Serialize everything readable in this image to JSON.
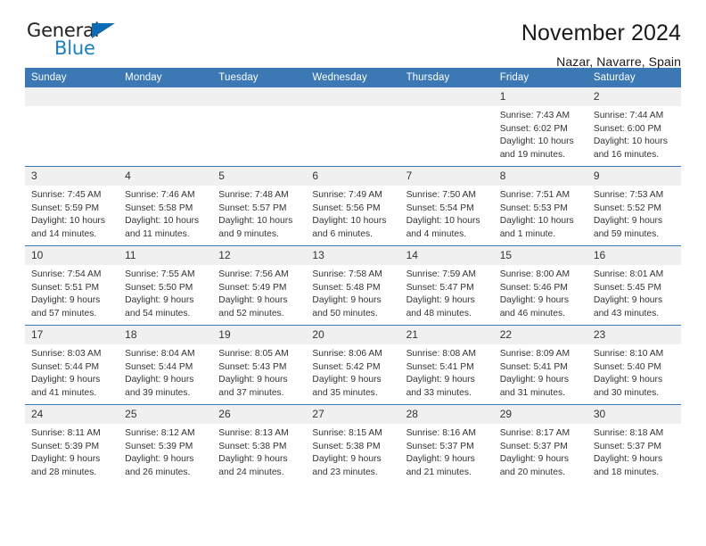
{
  "logo": {
    "word_one": "General",
    "word_two": "Blue",
    "triangle": "blue-triangle-icon",
    "brand_dark": "#231f20",
    "brand_blue": "#1a7fc1"
  },
  "header": {
    "title": "November 2024",
    "subtitle": "Nazar, Navarre, Spain"
  },
  "theme": {
    "header_blue": "#3b78b4",
    "daynum_band": "#f0f0f0",
    "text": "#333333"
  },
  "calendar": {
    "weekday_headers": [
      "Sunday",
      "Monday",
      "Tuesday",
      "Wednesday",
      "Thursday",
      "Friday",
      "Saturday"
    ],
    "weeks": [
      [
        {
          "day": "",
          "sunrise": "",
          "sunset": "",
          "daylight_line1": "",
          "daylight_line2": ""
        },
        {
          "day": "",
          "sunrise": "",
          "sunset": "",
          "daylight_line1": "",
          "daylight_line2": ""
        },
        {
          "day": "",
          "sunrise": "",
          "sunset": "",
          "daylight_line1": "",
          "daylight_line2": ""
        },
        {
          "day": "",
          "sunrise": "",
          "sunset": "",
          "daylight_line1": "",
          "daylight_line2": ""
        },
        {
          "day": "",
          "sunrise": "",
          "sunset": "",
          "daylight_line1": "",
          "daylight_line2": ""
        },
        {
          "day": "1",
          "sunrise": "Sunrise: 7:43 AM",
          "sunset": "Sunset: 6:02 PM",
          "daylight_line1": "Daylight: 10 hours",
          "daylight_line2": "and 19 minutes."
        },
        {
          "day": "2",
          "sunrise": "Sunrise: 7:44 AM",
          "sunset": "Sunset: 6:00 PM",
          "daylight_line1": "Daylight: 10 hours",
          "daylight_line2": "and 16 minutes."
        }
      ],
      [
        {
          "day": "3",
          "sunrise": "Sunrise: 7:45 AM",
          "sunset": "Sunset: 5:59 PM",
          "daylight_line1": "Daylight: 10 hours",
          "daylight_line2": "and 14 minutes."
        },
        {
          "day": "4",
          "sunrise": "Sunrise: 7:46 AM",
          "sunset": "Sunset: 5:58 PM",
          "daylight_line1": "Daylight: 10 hours",
          "daylight_line2": "and 11 minutes."
        },
        {
          "day": "5",
          "sunrise": "Sunrise: 7:48 AM",
          "sunset": "Sunset: 5:57 PM",
          "daylight_line1": "Daylight: 10 hours",
          "daylight_line2": "and 9 minutes."
        },
        {
          "day": "6",
          "sunrise": "Sunrise: 7:49 AM",
          "sunset": "Sunset: 5:56 PM",
          "daylight_line1": "Daylight: 10 hours",
          "daylight_line2": "and 6 minutes."
        },
        {
          "day": "7",
          "sunrise": "Sunrise: 7:50 AM",
          "sunset": "Sunset: 5:54 PM",
          "daylight_line1": "Daylight: 10 hours",
          "daylight_line2": "and 4 minutes."
        },
        {
          "day": "8",
          "sunrise": "Sunrise: 7:51 AM",
          "sunset": "Sunset: 5:53 PM",
          "daylight_line1": "Daylight: 10 hours",
          "daylight_line2": "and 1 minute."
        },
        {
          "day": "9",
          "sunrise": "Sunrise: 7:53 AM",
          "sunset": "Sunset: 5:52 PM",
          "daylight_line1": "Daylight: 9 hours",
          "daylight_line2": "and 59 minutes."
        }
      ],
      [
        {
          "day": "10",
          "sunrise": "Sunrise: 7:54 AM",
          "sunset": "Sunset: 5:51 PM",
          "daylight_line1": "Daylight: 9 hours",
          "daylight_line2": "and 57 minutes."
        },
        {
          "day": "11",
          "sunrise": "Sunrise: 7:55 AM",
          "sunset": "Sunset: 5:50 PM",
          "daylight_line1": "Daylight: 9 hours",
          "daylight_line2": "and 54 minutes."
        },
        {
          "day": "12",
          "sunrise": "Sunrise: 7:56 AM",
          "sunset": "Sunset: 5:49 PM",
          "daylight_line1": "Daylight: 9 hours",
          "daylight_line2": "and 52 minutes."
        },
        {
          "day": "13",
          "sunrise": "Sunrise: 7:58 AM",
          "sunset": "Sunset: 5:48 PM",
          "daylight_line1": "Daylight: 9 hours",
          "daylight_line2": "and 50 minutes."
        },
        {
          "day": "14",
          "sunrise": "Sunrise: 7:59 AM",
          "sunset": "Sunset: 5:47 PM",
          "daylight_line1": "Daylight: 9 hours",
          "daylight_line2": "and 48 minutes."
        },
        {
          "day": "15",
          "sunrise": "Sunrise: 8:00 AM",
          "sunset": "Sunset: 5:46 PM",
          "daylight_line1": "Daylight: 9 hours",
          "daylight_line2": "and 46 minutes."
        },
        {
          "day": "16",
          "sunrise": "Sunrise: 8:01 AM",
          "sunset": "Sunset: 5:45 PM",
          "daylight_line1": "Daylight: 9 hours",
          "daylight_line2": "and 43 minutes."
        }
      ],
      [
        {
          "day": "17",
          "sunrise": "Sunrise: 8:03 AM",
          "sunset": "Sunset: 5:44 PM",
          "daylight_line1": "Daylight: 9 hours",
          "daylight_line2": "and 41 minutes."
        },
        {
          "day": "18",
          "sunrise": "Sunrise: 8:04 AM",
          "sunset": "Sunset: 5:44 PM",
          "daylight_line1": "Daylight: 9 hours",
          "daylight_line2": "and 39 minutes."
        },
        {
          "day": "19",
          "sunrise": "Sunrise: 8:05 AM",
          "sunset": "Sunset: 5:43 PM",
          "daylight_line1": "Daylight: 9 hours",
          "daylight_line2": "and 37 minutes."
        },
        {
          "day": "20",
          "sunrise": "Sunrise: 8:06 AM",
          "sunset": "Sunset: 5:42 PM",
          "daylight_line1": "Daylight: 9 hours",
          "daylight_line2": "and 35 minutes."
        },
        {
          "day": "21",
          "sunrise": "Sunrise: 8:08 AM",
          "sunset": "Sunset: 5:41 PM",
          "daylight_line1": "Daylight: 9 hours",
          "daylight_line2": "and 33 minutes."
        },
        {
          "day": "22",
          "sunrise": "Sunrise: 8:09 AM",
          "sunset": "Sunset: 5:41 PM",
          "daylight_line1": "Daylight: 9 hours",
          "daylight_line2": "and 31 minutes."
        },
        {
          "day": "23",
          "sunrise": "Sunrise: 8:10 AM",
          "sunset": "Sunset: 5:40 PM",
          "daylight_line1": "Daylight: 9 hours",
          "daylight_line2": "and 30 minutes."
        }
      ],
      [
        {
          "day": "24",
          "sunrise": "Sunrise: 8:11 AM",
          "sunset": "Sunset: 5:39 PM",
          "daylight_line1": "Daylight: 9 hours",
          "daylight_line2": "and 28 minutes."
        },
        {
          "day": "25",
          "sunrise": "Sunrise: 8:12 AM",
          "sunset": "Sunset: 5:39 PM",
          "daylight_line1": "Daylight: 9 hours",
          "daylight_line2": "and 26 minutes."
        },
        {
          "day": "26",
          "sunrise": "Sunrise: 8:13 AM",
          "sunset": "Sunset: 5:38 PM",
          "daylight_line1": "Daylight: 9 hours",
          "daylight_line2": "and 24 minutes."
        },
        {
          "day": "27",
          "sunrise": "Sunrise: 8:15 AM",
          "sunset": "Sunset: 5:38 PM",
          "daylight_line1": "Daylight: 9 hours",
          "daylight_line2": "and 23 minutes."
        },
        {
          "day": "28",
          "sunrise": "Sunrise: 8:16 AM",
          "sunset": "Sunset: 5:37 PM",
          "daylight_line1": "Daylight: 9 hours",
          "daylight_line2": "and 21 minutes."
        },
        {
          "day": "29",
          "sunrise": "Sunrise: 8:17 AM",
          "sunset": "Sunset: 5:37 PM",
          "daylight_line1": "Daylight: 9 hours",
          "daylight_line2": "and 20 minutes."
        },
        {
          "day": "30",
          "sunrise": "Sunrise: 8:18 AM",
          "sunset": "Sunset: 5:37 PM",
          "daylight_line1": "Daylight: 9 hours",
          "daylight_line2": "and 18 minutes."
        }
      ]
    ]
  }
}
